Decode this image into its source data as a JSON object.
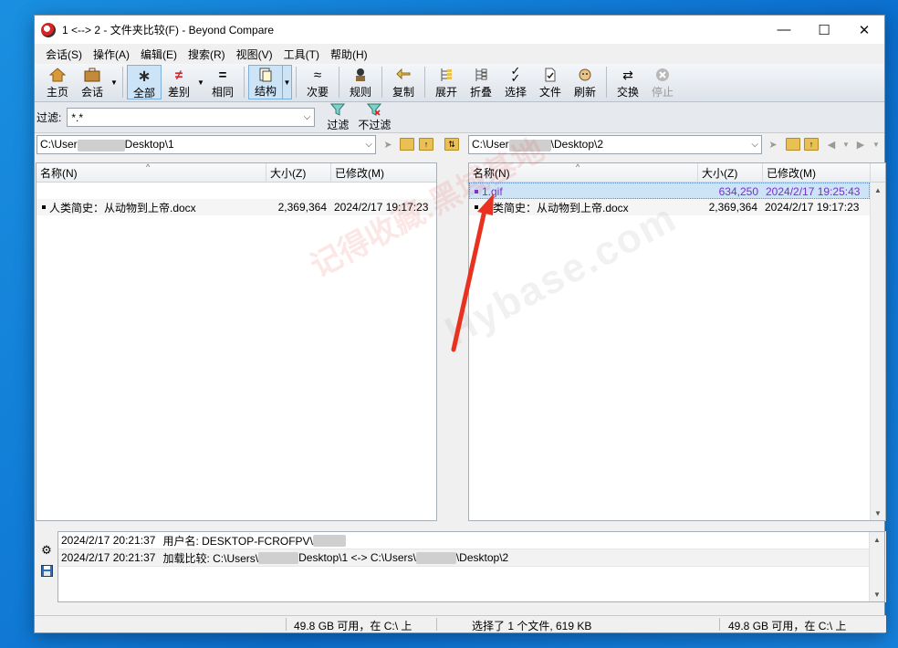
{
  "window": {
    "title": "1 <--> 2 - 文件夹比较(F) - Beyond Compare",
    "minimize": "—",
    "maximize": "☐",
    "close": "✕"
  },
  "menu": [
    "会话(S)",
    "操作(A)",
    "编辑(E)",
    "搜索(R)",
    "视图(V)",
    "工具(T)",
    "帮助(H)"
  ],
  "toolbar": {
    "home": "主页",
    "session": "会话",
    "all": "全部",
    "diffs": "差别",
    "same": "相同",
    "structure": "结构",
    "minor": "次要",
    "rules": "规则",
    "copy": "复制",
    "expand": "展开",
    "collapse": "折叠",
    "select": "选择",
    "files": "文件",
    "refresh": "刷新",
    "swap": "交换",
    "stop": "停止"
  },
  "filter": {
    "label": "过滤:",
    "value": "*.*",
    "filter_btn": "过滤",
    "nofilter_btn": "不过滤"
  },
  "left": {
    "path_prefix": "C:\\User",
    "path_suffix": "Desktop\\1",
    "columns": {
      "name": "名称(N)",
      "size": "大小(Z)",
      "modified": "已修改(M)"
    },
    "rows": [
      {
        "name": "",
        "size": "",
        "modified": ""
      },
      {
        "name": "人类简史：从动物到上帝.docx",
        "size": "2,369,364",
        "modified": "2024/2/17 19:17:23"
      }
    ]
  },
  "right": {
    "path_prefix": "C:\\User",
    "path_suffix": "\\Desktop\\2",
    "columns": {
      "name": "名称(N)",
      "size": "大小(Z)",
      "modified": "已修改(M)"
    },
    "rows": [
      {
        "name": "1.gif",
        "size": "634,250",
        "modified": "2024/2/17 19:25:43"
      },
      {
        "name": "人类简史：从动物到上帝.docx",
        "size": "2,369,364",
        "modified": "2024/2/17 19:17:23"
      }
    ]
  },
  "log": [
    {
      "time": "2024/2/17 20:21:37",
      "text": "用户名:   DESKTOP-FCROFPV\\"
    },
    {
      "time": "2024/2/17 20:21:37",
      "text": "加载比较:   C:\\Users\\",
      "text2": "Desktop\\1 <-> C:\\Users\\",
      "text3": "\\Desktop\\2"
    }
  ],
  "status": {
    "left": "49.8 GB 可用，在 C:\\ 上",
    "middle": "选择了 1 个文件, 619 KB",
    "right": "49.8 GB 可用，在 C:\\ 上"
  },
  "watermark": {
    "line1": "记得收藏:黑域基地",
    "line2": "Hybase.com"
  },
  "colors": {
    "orphan": "#7a2cd6",
    "arrow": "#e8321f",
    "selection": "#cde3f6"
  }
}
